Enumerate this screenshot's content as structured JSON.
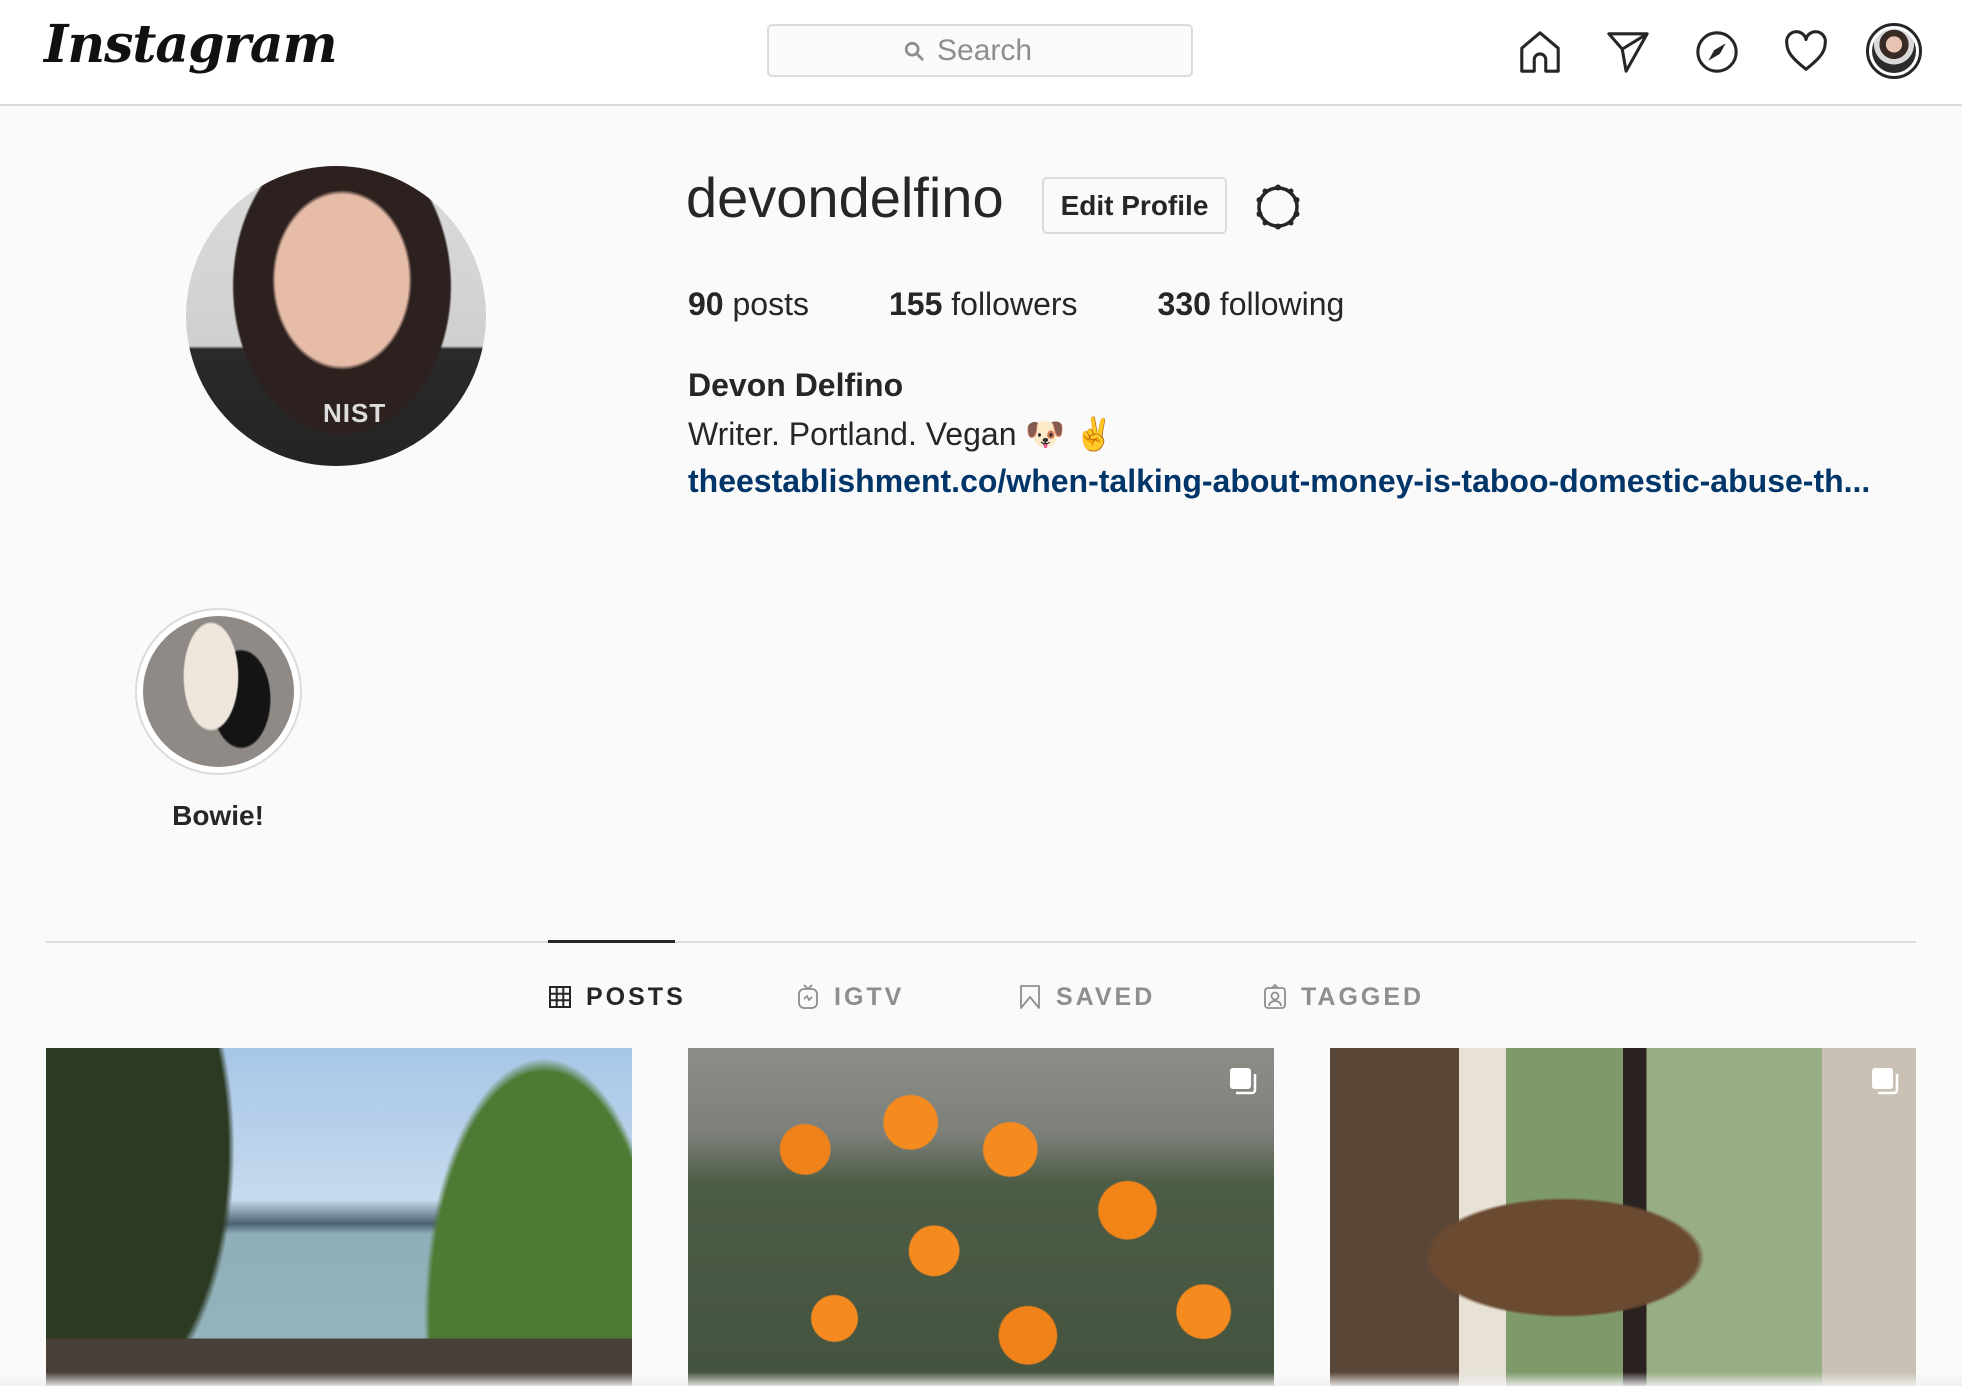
{
  "header": {
    "logo_text": "Instagram",
    "search": {
      "placeholder": "Search",
      "value": ""
    },
    "nav_icons": [
      "home-icon",
      "direct-messages-icon",
      "explore-compass-icon",
      "activity-heart-icon",
      "profile-avatar"
    ]
  },
  "profile": {
    "username": "devondelfino",
    "edit_profile_label": "Edit Profile",
    "settings_icon": "gear-icon",
    "stats": [
      {
        "count": "90",
        "label": "posts"
      },
      {
        "count": "155",
        "label": "followers"
      },
      {
        "count": "330",
        "label": "following"
      }
    ],
    "full_name": "Devon Delfino",
    "bio": "Writer. Portland. Vegan 🐶 ✌️",
    "link_text": "theestablishment.co/when-talking-about-money-is-taboo-domestic-abuse-th...",
    "avatar_shirt_text": "NIST"
  },
  "highlights": [
    {
      "label": "Bowie!"
    }
  ],
  "tabs": [
    {
      "label": "POSTS",
      "icon": "grid-icon",
      "active": true
    },
    {
      "label": "IGTV",
      "icon": "igtv-icon",
      "active": false
    },
    {
      "label": "SAVED",
      "icon": "bookmark-icon",
      "active": false
    },
    {
      "label": "TAGGED",
      "icon": "tagged-person-icon",
      "active": false
    }
  ],
  "posts": [
    {
      "description": "Bay view through trees",
      "multi_image": false
    },
    {
      "description": "Orange poppies on rocks",
      "multi_image": true
    },
    {
      "description": "Wooden table by glass doors",
      "multi_image": true
    }
  ],
  "colors": {
    "link": "#003569",
    "text": "#262626",
    "muted": "#8e8e8e",
    "border": "#dbdbdb",
    "background": "#fafafa"
  }
}
